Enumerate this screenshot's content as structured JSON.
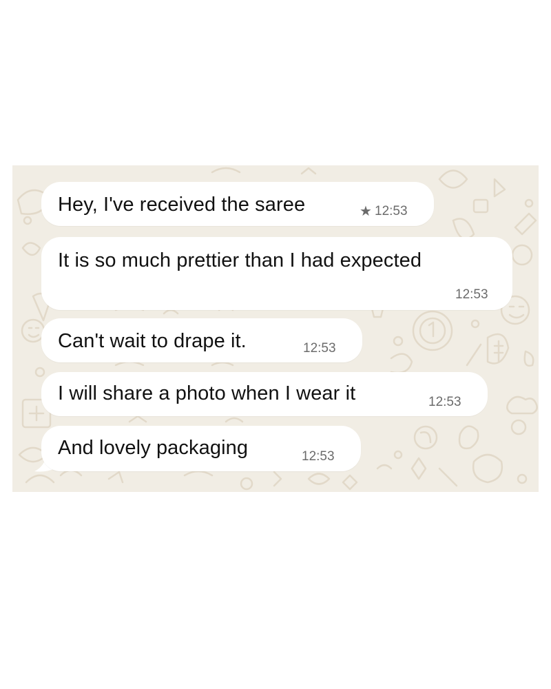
{
  "chat": {
    "messages": [
      {
        "text": "Hey, I've received the saree",
        "time": "12:53",
        "starred": true
      },
      {
        "text": "It is so much prettier than I had expected",
        "time": "12:53",
        "starred": false
      },
      {
        "text": "Can't wait to drape it.",
        "time": "12:53",
        "starred": false
      },
      {
        "text": "I will share a photo when I wear it",
        "time": "12:53",
        "starred": false
      },
      {
        "text": "And lovely packaging",
        "time": "12:53",
        "starred": false
      }
    ],
    "star_icon": "star-icon"
  },
  "colors": {
    "background": "#f1ede4",
    "bubble": "#ffffff",
    "text": "#111111",
    "time": "#6b6b6b",
    "doodle": "#e4dccd"
  }
}
